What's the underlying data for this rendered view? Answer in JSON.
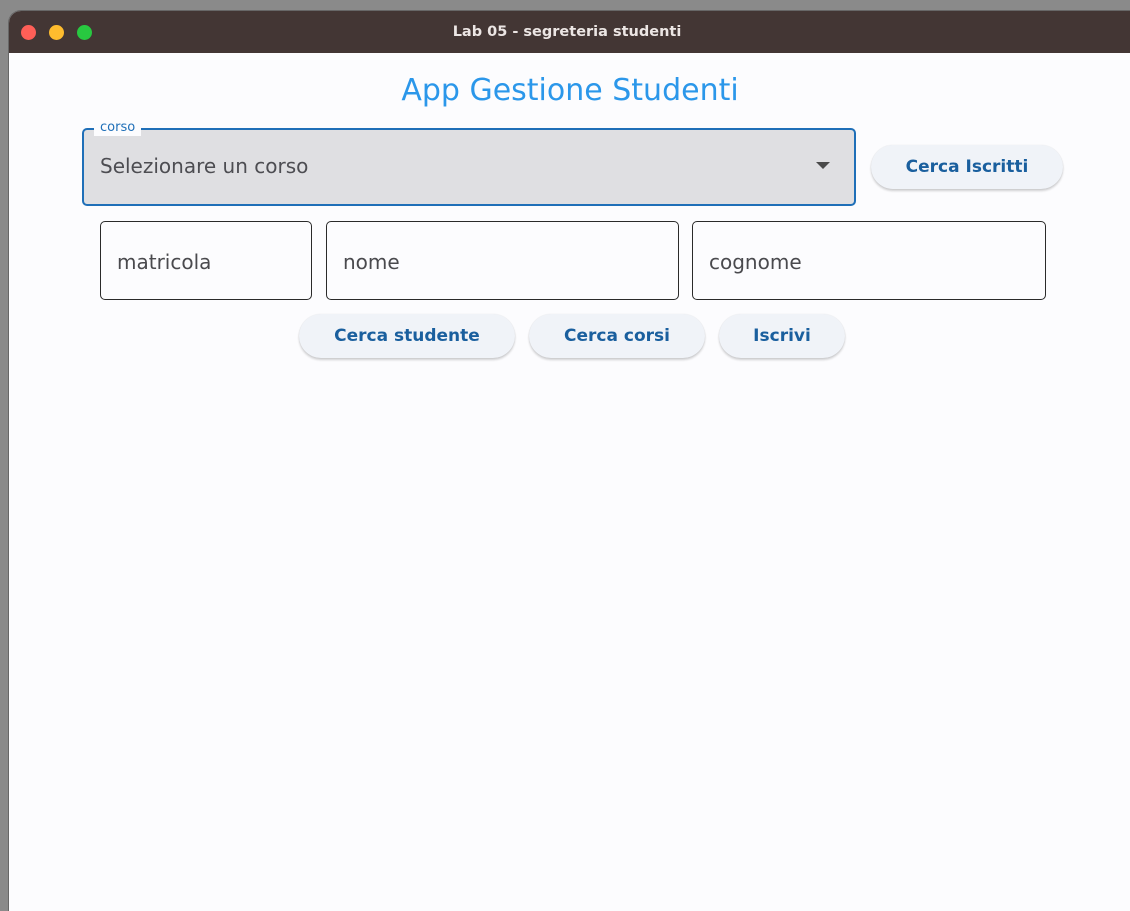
{
  "window": {
    "title": "Lab 05 - segreteria studenti"
  },
  "app": {
    "title": "App Gestione Studenti"
  },
  "corso_dropdown": {
    "label": "corso",
    "value": "Selezionare un corso",
    "icon": "arrow-drop-down-icon"
  },
  "buttons": {
    "cerca_iscritti": "Cerca Iscritti",
    "cerca_studente": "Cerca studente",
    "cerca_corsi": "Cerca corsi",
    "iscrivi": "Iscrivi"
  },
  "fields": {
    "matricola": "matricola",
    "nome": "nome",
    "cognome": "cognome"
  },
  "colors": {
    "accent": "#2b97ea",
    "button_text": "#1a5f9e",
    "focus_border": "#1f6fb8",
    "titlebar": "#433634"
  }
}
